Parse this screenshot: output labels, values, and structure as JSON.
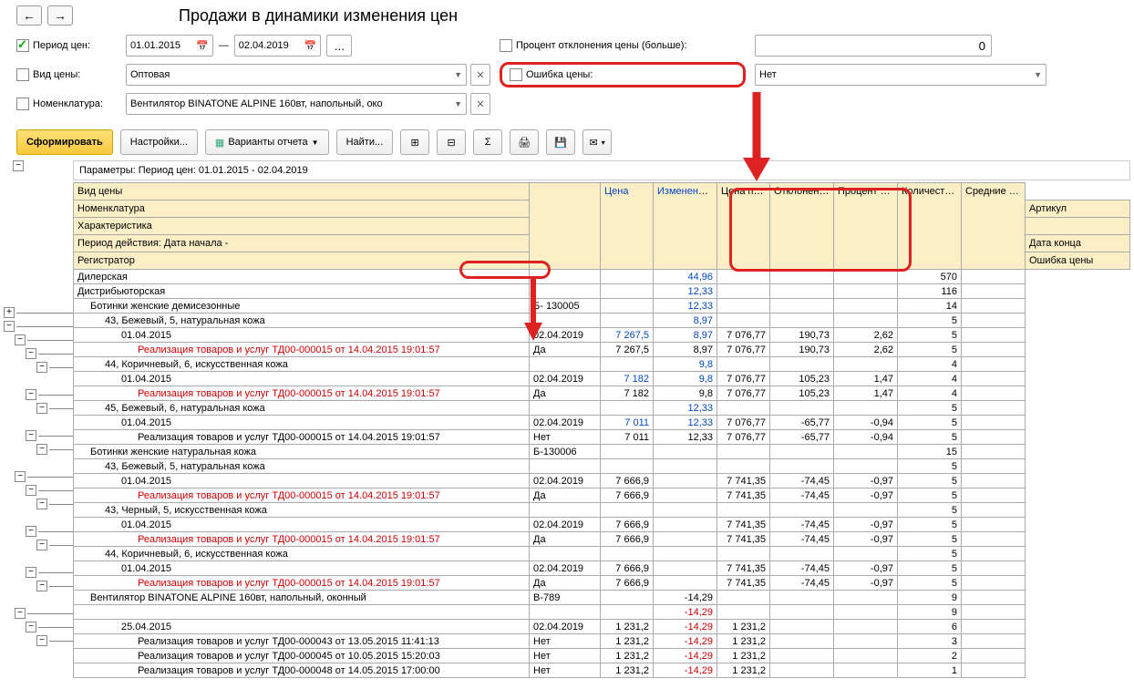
{
  "title": "Продажи в динамики изменения цен",
  "nav": {
    "back": "←",
    "fwd": "→"
  },
  "filters": {
    "period_label": "Период цен:",
    "period_checked": true,
    "date_from": "01.01.2015",
    "date_to": "02.04.2019",
    "dash": "—",
    "ellipsis": "...",
    "price_type_label": "Вид цены:",
    "price_type_value": "Оптовая",
    "nomenclature_label": "Номенклатура:",
    "nomenclature_value": "Вентилятор BINATONE ALPINE 160вт, напольный, око",
    "percent_dev_label": "Процент отклонения цены (больше):",
    "percent_dev_value": "0",
    "error_label": "Ошибка цены:",
    "error_value": "Нет"
  },
  "actions": {
    "generate": "Сформировать",
    "settings": "Настройки...",
    "variants": "Варианты отчета",
    "find": "Найти..."
  },
  "params_line": "Параметры:    Период цен: 01.01.2015 - 02.04.2019",
  "headers": {
    "vid": "Вид цены",
    "nom": "Номенклатура",
    "art": "Артикул",
    "har": "Характеристика",
    "period": "Период действия: Дата начала -",
    "date_end": "Дата конца",
    "reg": "Регистратор",
    "err": "Ошибка цены",
    "price": "Цена",
    "change": "Изменение цены в %",
    "sale_price": "Цена продажи",
    "dev": "Отклонение цены",
    "dev_pct": "Процент отклонения цены",
    "qty": "Количество продано",
    "avg": "Средние продажи в день"
  },
  "rows": [
    {
      "lvl": 0,
      "name": "Дилерская",
      "art": "",
      "dc": "",
      "p": "",
      "ch": "44,96",
      "sp": "",
      "dv": "",
      "dp": "",
      "q": "570",
      "blue": true
    },
    {
      "lvl": 0,
      "name": "Дистрибьюторская",
      "art": "",
      "dc": "",
      "p": "",
      "ch": "12,33",
      "sp": "",
      "dv": "",
      "dp": "",
      "q": "116",
      "blue": true
    },
    {
      "lvl": 1,
      "name": "Ботинки женские демисезонные",
      "art": "Б- 130005",
      "dc": "",
      "p": "",
      "ch": "12,33",
      "sp": "",
      "dv": "",
      "dp": "",
      "q": "14",
      "blue": true
    },
    {
      "lvl": 2,
      "name": "43, Бежевый, 5, натуральная кожа",
      "art": "",
      "dc": "",
      "p": "",
      "ch": "8,97",
      "sp": "",
      "dv": "",
      "dp": "",
      "q": "5",
      "blue": true
    },
    {
      "lvl": 3,
      "name": "01.04.2015",
      "art": "",
      "dc": "02.04.2019",
      "p": "7 267,5",
      "ch": "8,97",
      "sp": "7 076,77",
      "dv": "190,73",
      "dp": "2,62",
      "q": "5",
      "blue": true
    },
    {
      "lvl": 4,
      "name": "Реализация товаров и услуг ТД00-000015 от 14.04.2015 19:01:57",
      "art": "",
      "dc": "Да",
      "p": "7 267,5",
      "ch": "8,97",
      "sp": "7 076,77",
      "dv": "190,73",
      "dp": "2,62",
      "q": "5",
      "red": true
    },
    {
      "lvl": 2,
      "name": "44, Коричневый, 6, искусственная кожа",
      "art": "",
      "dc": "",
      "p": "",
      "ch": "9,8",
      "sp": "",
      "dv": "",
      "dp": "",
      "q": "4",
      "blue": true
    },
    {
      "lvl": 3,
      "name": "01.04.2015",
      "art": "",
      "dc": "02.04.2019",
      "p": "7 182",
      "ch": "9,8",
      "sp": "7 076,77",
      "dv": "105,23",
      "dp": "1,47",
      "q": "4",
      "blue": true
    },
    {
      "lvl": 4,
      "name": "Реализация товаров и услуг ТД00-000015 от 14.04.2015 19:01:57",
      "art": "",
      "dc": "Да",
      "p": "7 182",
      "ch": "9,8",
      "sp": "7 076,77",
      "dv": "105,23",
      "dp": "1,47",
      "q": "4",
      "red": true
    },
    {
      "lvl": 2,
      "name": "45, Бежевый, 6, натуральная кожа",
      "art": "",
      "dc": "",
      "p": "",
      "ch": "12,33",
      "sp": "",
      "dv": "",
      "dp": "",
      "q": "5",
      "blue": true
    },
    {
      "lvl": 3,
      "name": "01.04.2015",
      "art": "",
      "dc": "02.04.2019",
      "p": "7 011",
      "ch": "12,33",
      "sp": "7 076,77",
      "dv": "-65,77",
      "dp": "-0,94",
      "q": "5",
      "blue": true
    },
    {
      "lvl": 4,
      "name": "Реализация товаров и услуг ТД00-000015 от 14.04.2015 19:01:57",
      "art": "",
      "dc": "Нет",
      "p": "7 011",
      "ch": "12,33",
      "sp": "7 076,77",
      "dv": "-65,77",
      "dp": "-0,94",
      "q": "5"
    },
    {
      "lvl": 1,
      "name": "Ботинки женские натуральная кожа",
      "art": "Б-130006",
      "dc": "",
      "p": "",
      "ch": "",
      "sp": "",
      "dv": "",
      "dp": "",
      "q": "15"
    },
    {
      "lvl": 2,
      "name": "43, Бежевый, 5, натуральная кожа",
      "art": "",
      "dc": "",
      "p": "",
      "ch": "",
      "sp": "",
      "dv": "",
      "dp": "",
      "q": "5"
    },
    {
      "lvl": 3,
      "name": "01.04.2015",
      "art": "",
      "dc": "02.04.2019",
      "p": "7 666,9",
      "ch": "",
      "sp": "7 741,35",
      "dv": "-74,45",
      "dp": "-0,97",
      "q": "5"
    },
    {
      "lvl": 4,
      "name": "Реализация товаров и услуг ТД00-000015 от 14.04.2015 19:01:57",
      "art": "",
      "dc": "Да",
      "p": "7 666,9",
      "ch": "",
      "sp": "7 741,35",
      "dv": "-74,45",
      "dp": "-0,97",
      "q": "5",
      "red": true
    },
    {
      "lvl": 2,
      "name": "43, Черный, 5, искусственная кожа",
      "art": "",
      "dc": "",
      "p": "",
      "ch": "",
      "sp": "",
      "dv": "",
      "dp": "",
      "q": "5"
    },
    {
      "lvl": 3,
      "name": "01.04.2015",
      "art": "",
      "dc": "02.04.2019",
      "p": "7 666,9",
      "ch": "",
      "sp": "7 741,35",
      "dv": "-74,45",
      "dp": "-0,97",
      "q": "5"
    },
    {
      "lvl": 4,
      "name": "Реализация товаров и услуг ТД00-000015 от 14.04.2015 19:01:57",
      "art": "",
      "dc": "Да",
      "p": "7 666,9",
      "ch": "",
      "sp": "7 741,35",
      "dv": "-74,45",
      "dp": "-0,97",
      "q": "5",
      "red": true
    },
    {
      "lvl": 2,
      "name": "44, Коричневый, 6, искусственная кожа",
      "art": "",
      "dc": "",
      "p": "",
      "ch": "",
      "sp": "",
      "dv": "",
      "dp": "",
      "q": "5"
    },
    {
      "lvl": 3,
      "name": "01.04.2015",
      "art": "",
      "dc": "02.04.2019",
      "p": "7 666,9",
      "ch": "",
      "sp": "7 741,35",
      "dv": "-74,45",
      "dp": "-0,97",
      "q": "5"
    },
    {
      "lvl": 4,
      "name": "Реализация товаров и услуг ТД00-000015 от 14.04.2015 19:01:57",
      "art": "",
      "dc": "Да",
      "p": "7 666,9",
      "ch": "",
      "sp": "7 741,35",
      "dv": "-74,45",
      "dp": "-0,97",
      "q": "5",
      "red": true
    },
    {
      "lvl": 1,
      "name": "Вентилятор BINATONE ALPINE 160вт, напольный, оконный",
      "art": "В-789",
      "dc": "",
      "p": "",
      "ch": "-14,29",
      "sp": "",
      "dv": "",
      "dp": "",
      "q": "9",
      "negред": true
    },
    {
      "lvl": 2,
      "name": "",
      "art": "",
      "dc": "",
      "p": "",
      "ch": "-14,29",
      "sp": "",
      "dv": "",
      "dp": "",
      "q": "9",
      "negred": true
    },
    {
      "lvl": 3,
      "name": "25.04.2015",
      "art": "",
      "dc": "02.04.2019",
      "p": "1 231,2",
      "ch": "-14,29",
      "sp": "1 231,2",
      "dv": "",
      "dp": "",
      "q": "6",
      "negred": true
    },
    {
      "lvl": 4,
      "name": "Реализация товаров и услуг ТД00-000043 от 13.05.2015 11:41:13",
      "art": "",
      "dc": "Нет",
      "p": "1 231,2",
      "ch": "-14,29",
      "sp": "1 231,2",
      "dv": "",
      "dp": "",
      "q": "3",
      "negred": true
    },
    {
      "lvl": 4,
      "name": "Реализация товаров и услуг ТД00-000045 от 10.05.2015 15:20:03",
      "art": "",
      "dc": "Нет",
      "p": "1 231,2",
      "ch": "-14,29",
      "sp": "1 231,2",
      "dv": "",
      "dp": "",
      "q": "2",
      "negred": true
    },
    {
      "lvl": 4,
      "name": "Реализация товаров и услуг ТД00-000048 от 14.05.2015 17:00:00",
      "art": "",
      "dc": "Нет",
      "p": "1 231,2",
      "ch": "-14,29",
      "sp": "1 231,2",
      "dv": "",
      "dp": "",
      "q": "1",
      "negred": true
    }
  ]
}
